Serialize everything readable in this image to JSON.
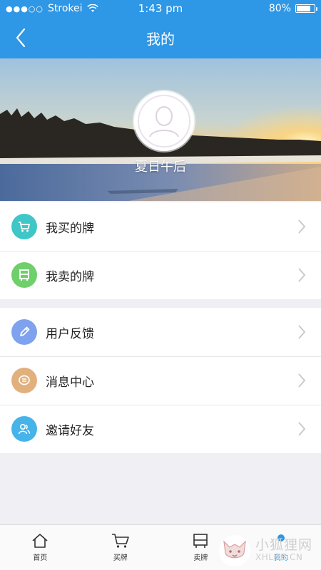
{
  "status_bar": {
    "carrier": "Strokei",
    "time": "1:43 pm",
    "battery_percent": "80%",
    "battery_level": 0.8
  },
  "nav": {
    "title": "我的",
    "back_icon": "chevron-left-icon"
  },
  "profile": {
    "username": "夏日午后",
    "avatar_icon": "user-silhouette-icon"
  },
  "menu_group_1": [
    {
      "label": "我买的牌",
      "icon": "cart-icon",
      "icon_color": "#3fc6c6"
    },
    {
      "label": "我卖的牌",
      "icon": "plate-icon",
      "icon_color": "#6fcf6b"
    }
  ],
  "menu_group_2": [
    {
      "label": "用户反馈",
      "icon": "pencil-icon",
      "icon_color": "#7fa2ee"
    },
    {
      "label": "消息中心",
      "icon": "message-icon",
      "icon_color": "#e2b07c"
    },
    {
      "label": "邀请好友",
      "icon": "users-icon",
      "icon_color": "#46b3e9"
    }
  ],
  "tabbar": [
    {
      "label": "首页",
      "icon": "home-icon"
    },
    {
      "label": "买牌",
      "icon": "cart-icon"
    },
    {
      "label": "卖牌",
      "icon": "plate-icon"
    },
    {
      "label": "我的",
      "icon": "user-icon",
      "active": true
    }
  ],
  "watermark": {
    "text_cn": "小狐狸网",
    "text_en": "XHLHB.CN"
  },
  "colors": {
    "primary": "#2e97e6",
    "background": "#efeff4"
  }
}
